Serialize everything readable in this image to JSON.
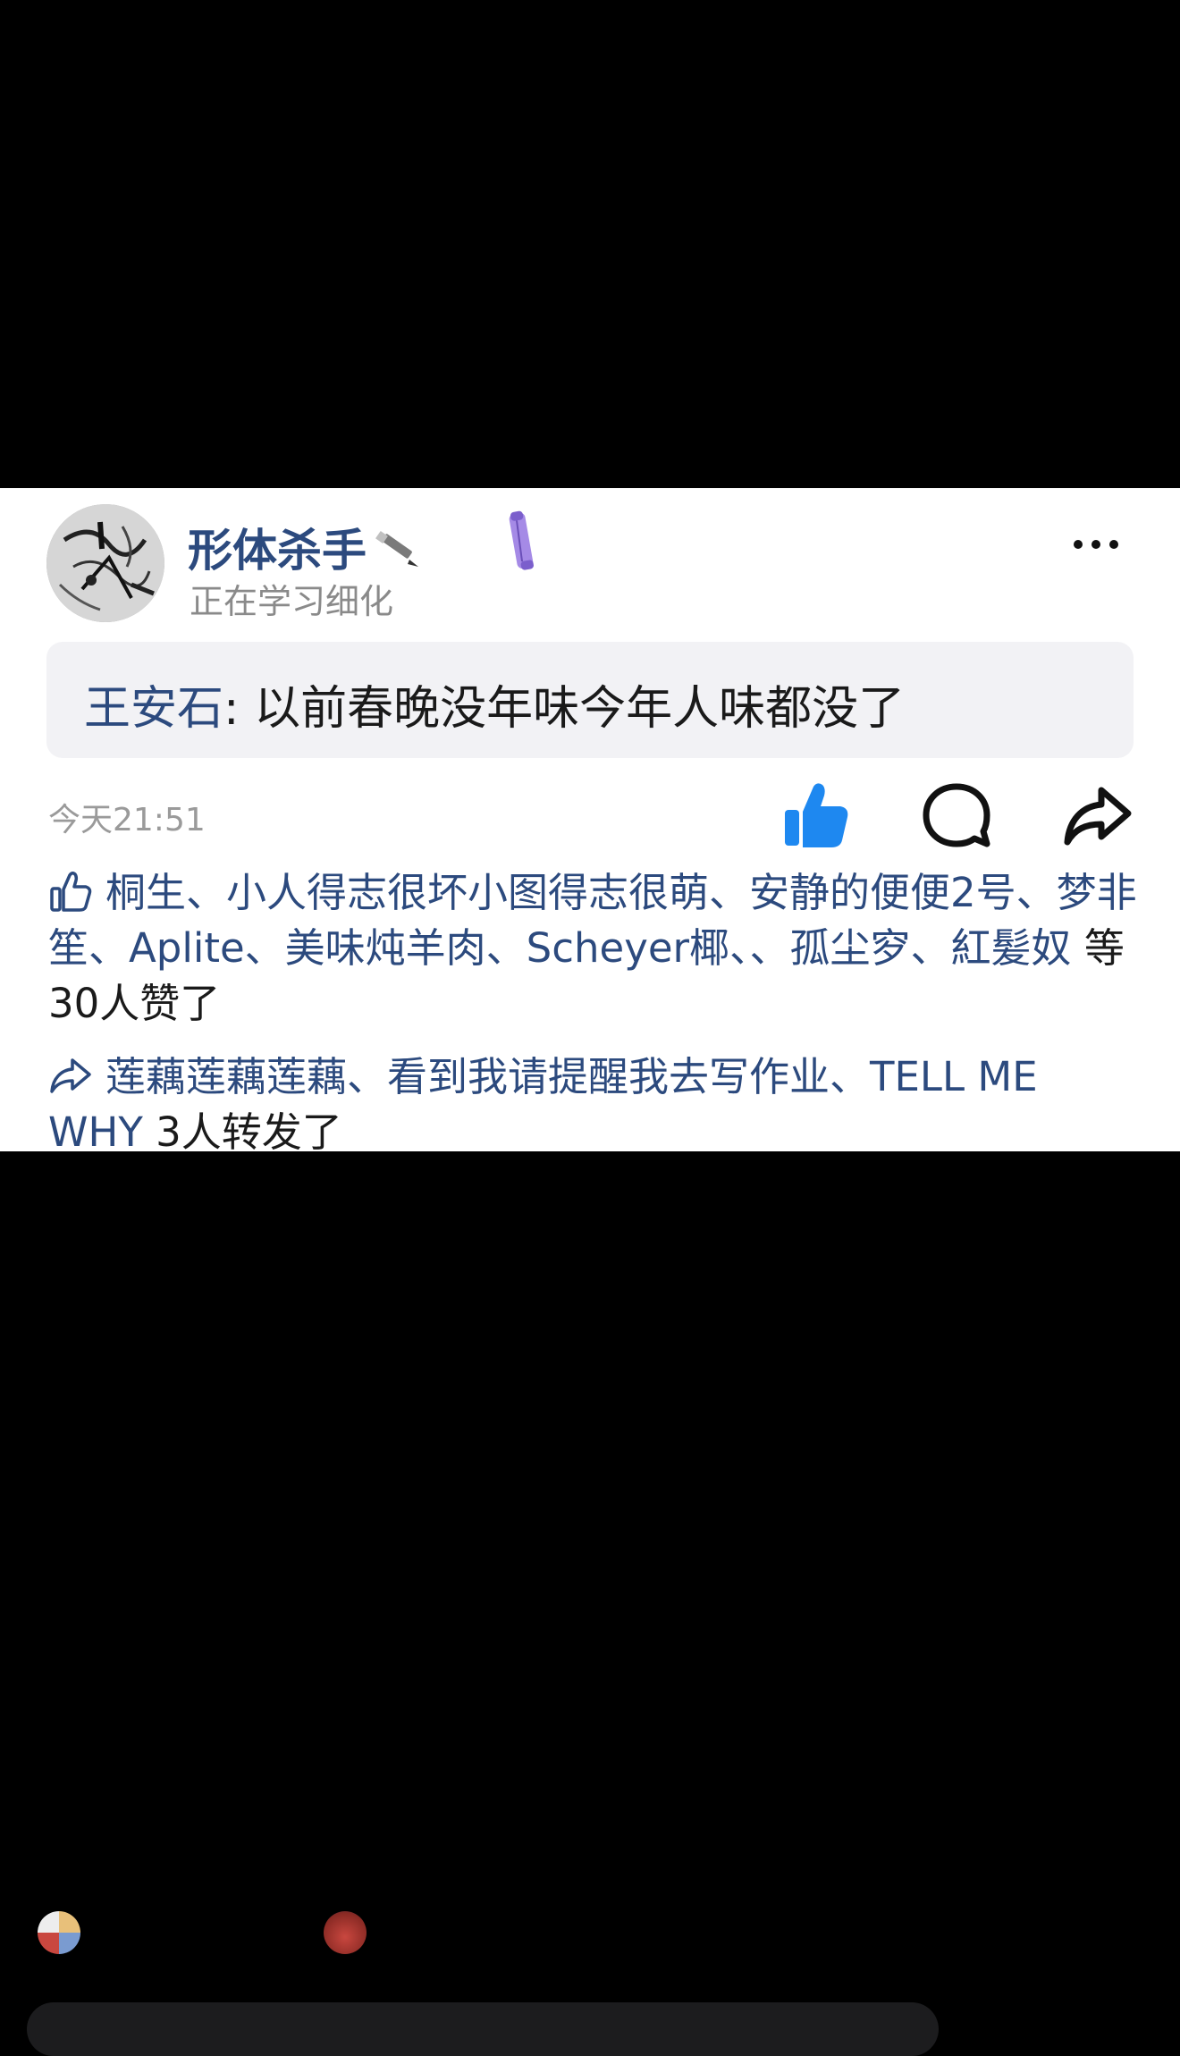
{
  "post": {
    "username": "形体杀手",
    "status": "正在学习细化",
    "quote_author": "王安石",
    "quote_separator": ": ",
    "quote_text": "以前春晚没年味今年人味都没了",
    "time": "今天21:51"
  },
  "likes": {
    "names": "桐生、小人得志很坏小图得志很萌、安静的便便2号、梦非笙、Aplite、美味炖羊肉、Scheyer椰、、孤尘穸、紅髪奴",
    "suffix": "等30人赞了"
  },
  "reposts": {
    "names": "莲藕莲藕莲藕、看到我请提醒我去写作业、TELL ME WHY",
    "suffix": "3人转发了"
  },
  "icons": {
    "avatar": "avatar-sketch",
    "name_emoji": "pencil-icon",
    "badge": "purple-badge-icon",
    "more": "more-icon",
    "like": "thumbs-up-icon",
    "comment": "comment-icon",
    "share": "share-icon"
  },
  "colors": {
    "name_blue": "#2c4a7e",
    "like_active": "#1e88f0",
    "badge_purple": "#9b7fe0"
  }
}
